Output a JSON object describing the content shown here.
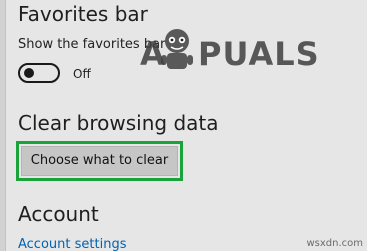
{
  "favorites_bar": {
    "heading": "Favorites bar",
    "toggle_label": "Show the favorites bar",
    "toggle_state": "Off"
  },
  "clear_browsing": {
    "heading": "Clear browsing data",
    "button_label": "Choose what to clear"
  },
  "account": {
    "heading": "Account",
    "settings_link": "Account settings"
  },
  "watermark": {
    "logo_text_left": "A",
    "logo_text_right": "PUALS",
    "site": "wsxdn.com"
  },
  "colors": {
    "background": "#e6e6e6",
    "highlight": "#1aa33a",
    "button": "#c6c6c6",
    "link": "#0063b1"
  },
  "icons": {
    "mascot": "appuals-mascot-icon"
  }
}
